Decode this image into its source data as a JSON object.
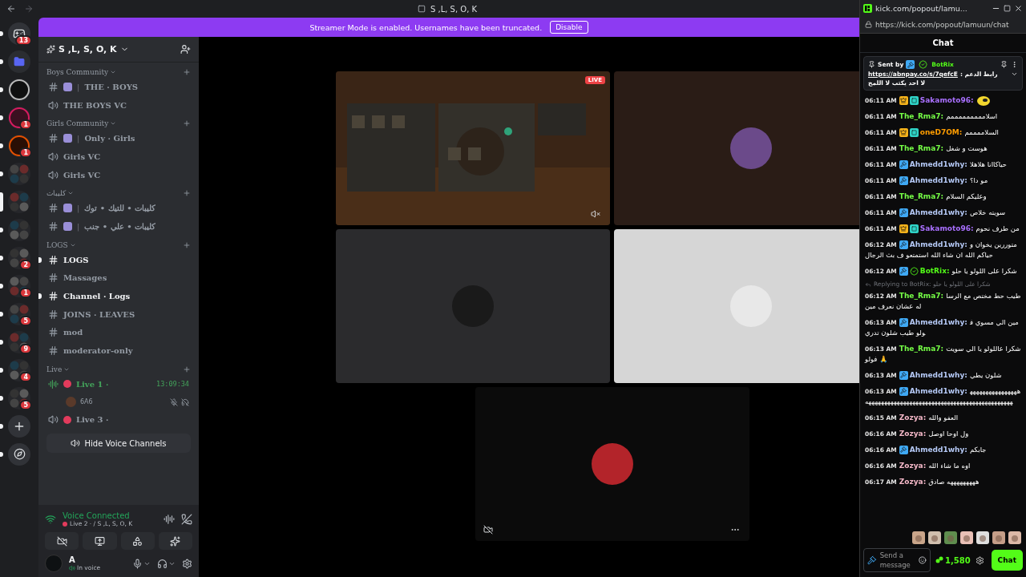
{
  "titlebar": {
    "title": "S ,L, S, O, K"
  },
  "banner": {
    "message": "Streamer Mode is enabled. Usernames have been truncated.",
    "button": "Disable"
  },
  "servers": [
    {
      "kind": "home",
      "badge": "13",
      "selected": false
    },
    {
      "kind": "folder",
      "selected": false
    },
    {
      "kind": "logo",
      "selected": false
    },
    {
      "kind": "logo",
      "badge": "1",
      "selected": false
    },
    {
      "kind": "logo",
      "badge": "1",
      "selected": false
    },
    {
      "kind": "group",
      "selected": false
    },
    {
      "kind": "group",
      "selected": true
    },
    {
      "kind": "group",
      "selected": false
    },
    {
      "kind": "group",
      "badge": "2",
      "selected": false
    },
    {
      "kind": "group",
      "badge": "1",
      "selected": false
    },
    {
      "kind": "group",
      "badge": "5",
      "selected": false
    },
    {
      "kind": "group",
      "badge": "9",
      "selected": false
    },
    {
      "kind": "group",
      "badge": "4",
      "selected": false
    },
    {
      "kind": "group",
      "badge": "5",
      "selected": false
    },
    {
      "kind": "add",
      "selected": false
    },
    {
      "kind": "discover",
      "selected": false
    }
  ],
  "sidebar": {
    "server_name": "S ,L, S, O, K",
    "sections": [
      {
        "name": "Boys Community",
        "channels": [
          {
            "kind": "text",
            "name": "THE · BOYS",
            "separator": "|",
            "unread": false
          },
          {
            "kind": "voice",
            "name": "THE BOYS VC",
            "unread": false
          }
        ]
      },
      {
        "name": "Girls Community",
        "channels": [
          {
            "kind": "text",
            "name": "Only · Girls",
            "separator": "|",
            "unread": false
          },
          {
            "kind": "voice",
            "name": "Girls VC",
            "unread": false
          },
          {
            "kind": "voice",
            "name": "Girls VC",
            "unread": false
          }
        ]
      },
      {
        "name": "كليبات",
        "channels": [
          {
            "kind": "text",
            "name": "كليبات • للتيك • توك",
            "separator": "|",
            "unread": false
          },
          {
            "kind": "text",
            "name": "كليبات • علي • جنب",
            "separator": "|",
            "unread": false
          }
        ]
      },
      {
        "name": "LOGS",
        "channels": [
          {
            "kind": "text",
            "name": "LOGS",
            "unread": true
          },
          {
            "kind": "text",
            "name": "Massages",
            "unread": false
          },
          {
            "kind": "text",
            "name": "Channel · Logs",
            "unread": true
          },
          {
            "kind": "text",
            "name": "JOINS · LEAVES",
            "unread": false
          },
          {
            "kind": "text",
            "name": "mod",
            "unread": false
          },
          {
            "kind": "text",
            "name": "moderator-only",
            "unread": false
          }
        ]
      },
      {
        "name": "Live",
        "channels": [
          {
            "kind": "live",
            "name": "Live 1 ·",
            "active": true,
            "timer": "13:09:34",
            "members": [
              {
                "name": "6A6",
                "muted": true,
                "deafened": true
              }
            ]
          },
          {
            "kind": "live",
            "name": "Live 3 ·",
            "active": false
          }
        ]
      }
    ],
    "hide_button": "Hide Voice Channels"
  },
  "voice_panel": {
    "status": "Voice Connected",
    "channel": "Live 2 ·  / S ,L, S, O, K"
  },
  "user_panel": {
    "name": "A",
    "status": "In voice"
  },
  "stage": {
    "tiles": [
      {
        "kind": "stream",
        "badge": "LIVE",
        "muted": true
      },
      {
        "kind": "user"
      },
      {
        "kind": "user"
      },
      {
        "kind": "user"
      },
      {
        "kind": "self"
      }
    ]
  },
  "chat": {
    "window_title": "kick.com/popout/lamu...",
    "url": "https://kick.com/popout/lamuun/chat",
    "heading": "Chat",
    "pinned": {
      "label": "Sent by",
      "user": "BotRix",
      "badges": [
        {
          "kind": "moderator"
        },
        {
          "kind": "verified"
        }
      ],
      "link": "https://abnpay.co/s/7qefcE",
      "text": ": رابط الدعم",
      "line2": "لا احد يكتب لا اللمح"
    },
    "messages": [
      {
        "time": "06:11 AM",
        "badges": [
          {
            "kind": "crown"
          },
          {
            "kind": "og"
          }
        ],
        "user": "Sakamoto96:",
        "color": "#a970ff",
        "emote": true
      },
      {
        "time": "06:11 AM",
        "user": "The_Rma7:",
        "color": "#75fd46",
        "text": "اسلامممممممممم"
      },
      {
        "time": "06:11 AM",
        "badges": [
          {
            "kind": "crown"
          },
          {
            "kind": "og"
          }
        ],
        "user": "oneD7OM:",
        "color": "#ff9d00",
        "text": "السلاممممم"
      },
      {
        "time": "06:11 AM",
        "user": "The_Rma7:",
        "color": "#75fd46",
        "text": "هوست و شغل"
      },
      {
        "time": "06:11 AM",
        "badges": [
          {
            "kind": "moderator"
          }
        ],
        "user": "Ahmedd1why:",
        "color": "#b4c8f5",
        "text": "حياكاانا هلاهلا"
      },
      {
        "time": "06:11 AM",
        "badges": [
          {
            "kind": "moderator"
          }
        ],
        "user": "Ahmedd1why:",
        "color": "#b4c8f5",
        "text": "مو دا؟"
      },
      {
        "time": "06:11 AM",
        "user": "The_Rma7:",
        "color": "#75fd46",
        "text": "وعليكم السلام"
      },
      {
        "time": "06:11 AM",
        "badges": [
          {
            "kind": "moderator"
          }
        ],
        "user": "Ahmedd1why:",
        "color": "#b4c8f5",
        "text": "سويته خلاص"
      },
      {
        "time": "06:11 AM",
        "badges": [
          {
            "kind": "crown"
          },
          {
            "kind": "og"
          }
        ],
        "user": "Sakamoto96:",
        "color": "#a970ff",
        "text": "من طرف نحوم"
      },
      {
        "time": "06:12 AM",
        "badges": [
          {
            "kind": "moderator"
          }
        ],
        "user": "Ahmedd1why:",
        "color": "#b4c8f5",
        "text": "متوررين يخوان و حياكم الله ان شاء الله استمتعو ف بث الرجال"
      },
      {
        "time": "06:12 AM",
        "badges": [
          {
            "kind": "moderator"
          },
          {
            "kind": "verified"
          }
        ],
        "user": "BotRix:",
        "color": "#53fc18",
        "text": "شكرا على اللولو يا حلو"
      },
      {
        "time": "06:12 AM",
        "user": "The_Rma7:",
        "color": "#75fd46",
        "text": "طيب حط مختص مع الرساله عشان نعرف مين",
        "reply_to": "Replying to BotRix:",
        "reply_text": "شكرا على اللولو يا حلو"
      },
      {
        "time": "06:13 AM",
        "badges": [
          {
            "kind": "moderator"
          }
        ],
        "user": "Ahmedd1why:",
        "color": "#b4c8f5",
        "text": "مين الي مسوي فولو طيب شلون تدري"
      },
      {
        "time": "06:13 AM",
        "user": "The_Rma7:",
        "color": "#75fd46",
        "text": "شكرا عاللولو يا الي سويت فولو 🙏"
      },
      {
        "time": "06:13 AM",
        "badges": [
          {
            "kind": "moderator"
          }
        ],
        "user": "Ahmedd1why:",
        "color": "#b4c8f5",
        "text": "شلون يطي"
      },
      {
        "time": "06:13 AM",
        "badges": [
          {
            "kind": "moderator"
          }
        ],
        "user": "Ahmedd1why:",
        "color": "#b4c8f5",
        "text": "ههههههههههههههههههههههههههههههههههههههههههههههههههههههههههههههه"
      },
      {
        "time": "06:15 AM",
        "user": "Zozya:",
        "color": "#f4b8c8",
        "text": "العفو والله"
      },
      {
        "time": "06:16 AM",
        "user": "Zozya:",
        "color": "#f4b8c8",
        "text": "ول اوحا اوصل"
      },
      {
        "time": "06:16 AM",
        "badges": [
          {
            "kind": "moderator"
          }
        ],
        "user": "Ahmedd1why:",
        "color": "#b4c8f5",
        "text": "جابكم"
      },
      {
        "time": "06:16 AM",
        "user": "Zozya:",
        "color": "#f4b8c8",
        "text": "اوه ما شاء الله"
      },
      {
        "time": "06:17 AM",
        "user": "Zozya:",
        "color": "#f4b8c8",
        "text": "هههههههههه صادق"
      }
    ],
    "composer": {
      "placeholder": "Send a message",
      "points": "1,580",
      "button": "Chat"
    }
  }
}
